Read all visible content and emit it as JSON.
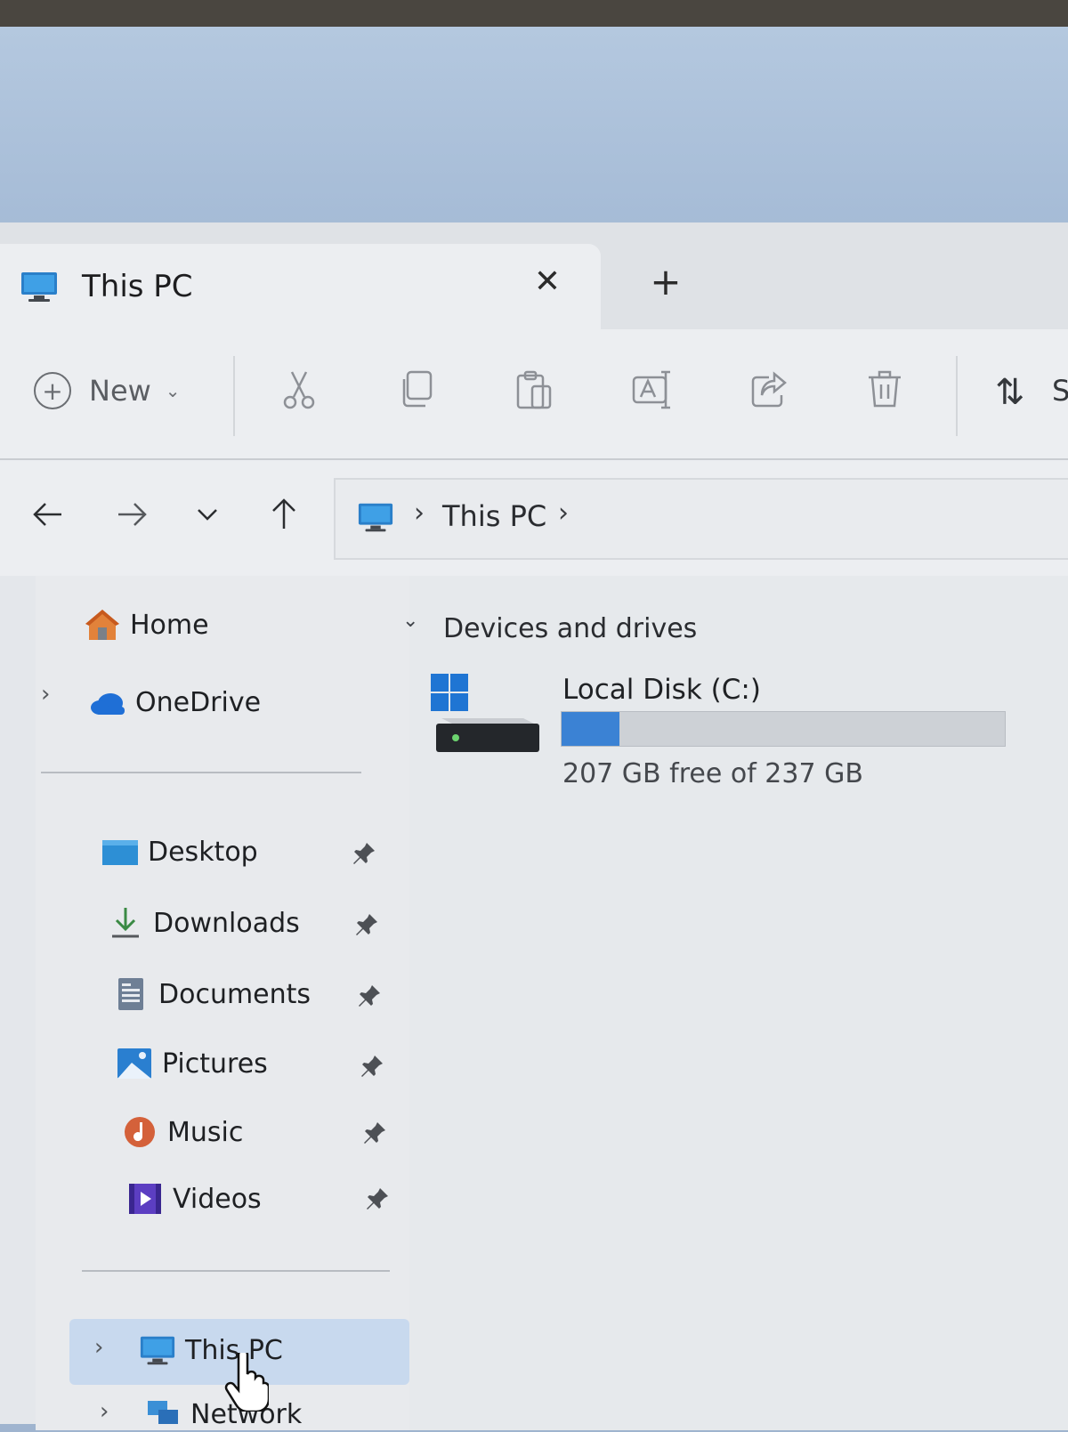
{
  "window": {
    "tab_title": "This PC",
    "close_glyph": "✕",
    "new_tab_glyph": "+"
  },
  "toolbar": {
    "new_label": "New",
    "new_chevron": "⌄",
    "buttons": [
      "cut-icon",
      "copy-icon",
      "paste-icon",
      "rename-icon",
      "share-icon",
      "delete-icon"
    ],
    "sort_glyph": "⇅",
    "sort_label_partial": "S"
  },
  "nav": {
    "back": "back-arrow-icon",
    "forward": "forward-arrow-icon",
    "recent": "chevron-down-icon",
    "up": "up-arrow-icon"
  },
  "address": {
    "sep": "›",
    "path": "This PC",
    "trailing_sep": "›"
  },
  "sidebar": {
    "home": "Home",
    "onedrive": "OneDrive",
    "expand_glyph": "›",
    "quick_access": [
      {
        "label": "Desktop",
        "icon": "desktop-folder-icon"
      },
      {
        "label": "Downloads",
        "icon": "downloads-icon"
      },
      {
        "label": "Documents",
        "icon": "documents-icon"
      },
      {
        "label": "Pictures",
        "icon": "pictures-icon"
      },
      {
        "label": "Music",
        "icon": "music-icon"
      },
      {
        "label": "Videos",
        "icon": "videos-icon"
      }
    ],
    "this_pc": "This PC",
    "network": "Network"
  },
  "content": {
    "section_chevron": "⌄",
    "section_title": "Devices and drives",
    "drive": {
      "name": "Local Disk (C:)",
      "free_text": "207 GB free of 237 GB",
      "used_fraction": 0.13
    }
  },
  "colors": {
    "accent": "#3b82d4",
    "selected": "#c8d9ee"
  }
}
